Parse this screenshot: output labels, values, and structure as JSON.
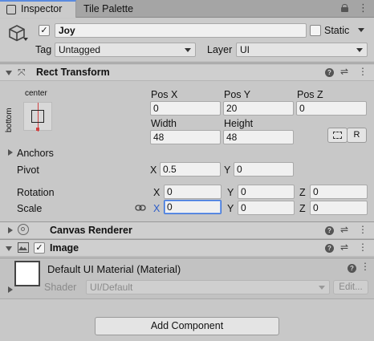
{
  "tabs": [
    {
      "label": "Inspector",
      "icon": "info-icon"
    },
    {
      "label": "Tile Palette"
    }
  ],
  "gameobject": {
    "name": "Joy",
    "active": true,
    "static_label": "Static",
    "tag_label": "Tag",
    "tag_value": "Untagged",
    "layer_label": "Layer",
    "layer_value": "UI"
  },
  "rect_transform": {
    "title": "Rect Transform",
    "anchor_preset_h": "center",
    "anchor_preset_v": "bottom",
    "pos_x_label": "Pos X",
    "pos_x": "0",
    "pos_y_label": "Pos Y",
    "pos_y": "20",
    "pos_z_label": "Pos Z",
    "pos_z": "0",
    "width_label": "Width",
    "width": "48",
    "height_label": "Height",
    "height": "48",
    "raw_edit_label": "R",
    "anchors_label": "Anchors",
    "pivot_label": "Pivot",
    "pivot_x": "0.5",
    "pivot_y": "0",
    "rotation_label": "Rotation",
    "rot_x": "0",
    "rot_y": "0",
    "rot_z": "0",
    "scale_label": "Scale",
    "scale_x": "0",
    "scale_y": "0",
    "scale_z": "0",
    "axis_x": "X",
    "axis_y": "Y",
    "axis_z": "Z"
  },
  "canvas_renderer": {
    "title": "Canvas Renderer"
  },
  "image": {
    "title": "Image",
    "enabled": true
  },
  "material": {
    "name": "Default UI Material (Material)",
    "shader_label": "Shader",
    "shader_value": "UI/Default",
    "edit_label": "Edit..."
  },
  "add_component_label": "Add Component"
}
